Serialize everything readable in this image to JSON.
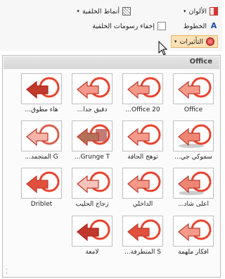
{
  "ribbon": {
    "colors_label": "الألوان",
    "fonts_label": "الخطوط",
    "effects_label": "التأثيرات",
    "background_styles_label": "أنماط الخلفية",
    "hide_background_label": "إخفاء رسومات الخلفية"
  },
  "gallery": {
    "section_title": "Office",
    "items": [
      {
        "label": "Office",
        "style": "plain"
      },
      {
        "label": "Office 20...",
        "style": "plain"
      },
      {
        "label": "دقيق جدا...",
        "style": "subtle"
      },
      {
        "label": "هاء مطوق...",
        "style": "dark"
      },
      {
        "label": "سموكي جي...",
        "style": "smoky"
      },
      {
        "label": "توهج الحافة",
        "style": "glow"
      },
      {
        "label": "Grunge T...",
        "style": "grunge"
      },
      {
        "label": "G المتجمد...",
        "style": "frosted"
      },
      {
        "label": "أعلى شاد...",
        "style": "shadow"
      },
      {
        "label": "الداخلي",
        "style": "inset"
      },
      {
        "label": "زجاج الحليب",
        "style": "milk"
      },
      {
        "label": "Driblet",
        "style": "driblet"
      },
      {
        "label": "أفكار ملهمة",
        "style": "glow2"
      },
      {
        "label": "S المتطرفة...",
        "style": "extreme"
      },
      {
        "label": "لامعة",
        "style": "glossy"
      }
    ]
  },
  "colors": {
    "accent": "#e8442f",
    "arrow": "#f59a8a",
    "dark": "#b0211a"
  }
}
